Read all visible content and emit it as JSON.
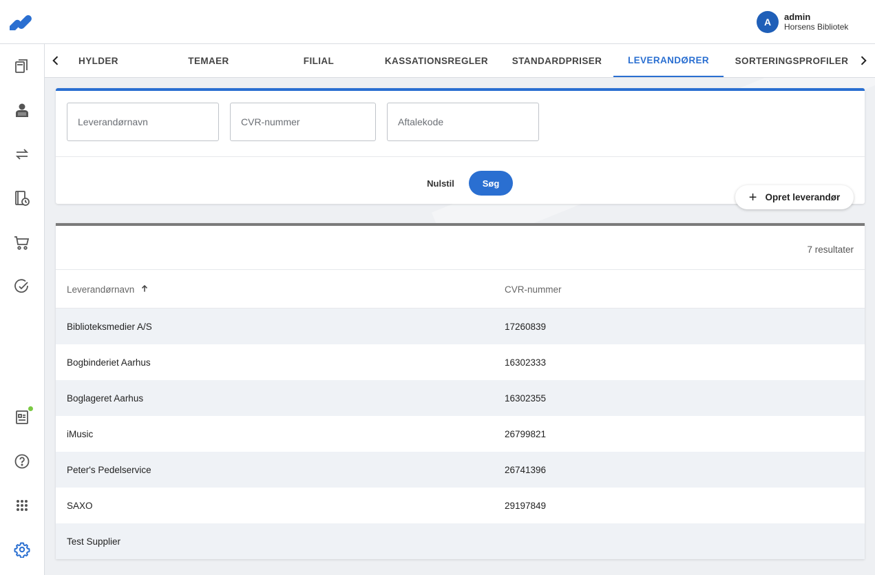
{
  "user": {
    "initial": "A",
    "name": "admin",
    "org": "Horsens Bibliotek"
  },
  "tabs": [
    {
      "label": "HYLDER",
      "active": false
    },
    {
      "label": "TEMAER",
      "active": false
    },
    {
      "label": "FILIAL",
      "active": false
    },
    {
      "label": "KASSATIONSREGLER",
      "active": false
    },
    {
      "label": "STANDARDPRISER",
      "active": false
    },
    {
      "label": "LEVERANDØRER",
      "active": true
    },
    {
      "label": "SORTERINGSPROFILER",
      "active": false
    }
  ],
  "search": {
    "supplier_placeholder": "Leverandørnavn",
    "cvr_placeholder": "CVR-nummer",
    "agreement_placeholder": "Aftalekode",
    "reset_label": "Nulstil",
    "search_label": "Søg"
  },
  "create_label": "Opret leverandør",
  "results": {
    "count_label": "7 resultater",
    "columns": [
      "Leverandørnavn",
      "CVR-nummer"
    ],
    "sort_icon": "arrow-up-icon",
    "rows": [
      {
        "name": "Biblioteksmedier A/S",
        "cvr": "17260839"
      },
      {
        "name": "Bogbinderiet Aarhus",
        "cvr": "16302333"
      },
      {
        "name": "Boglageret Aarhus",
        "cvr": "16302355"
      },
      {
        "name": "iMusic",
        "cvr": "26799821"
      },
      {
        "name": "Peter's Pedelservice",
        "cvr": "26741396"
      },
      {
        "name": "SAXO",
        "cvr": "29197849"
      },
      {
        "name": "Test Supplier",
        "cvr": ""
      }
    ]
  },
  "sidebar_icons": [
    "books-icon",
    "reader-icon",
    "transfer-arrows-icon",
    "book-clock-icon",
    "cart-icon",
    "check-circle-icon",
    "report-icon",
    "help-icon",
    "apps-grid-icon",
    "settings-gear-icon"
  ],
  "colors": {
    "accent": "#2a6fd1",
    "avatar": "#1f5fb8",
    "notification_dot": "#7ac943"
  }
}
